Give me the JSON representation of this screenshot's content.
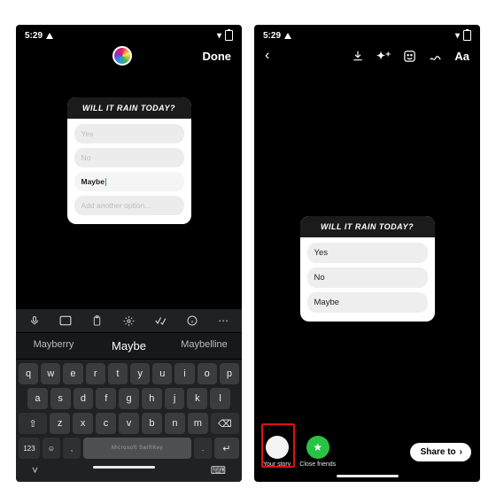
{
  "status": {
    "time": "5:29"
  },
  "left": {
    "toolbar": {
      "done": "Done"
    },
    "poll": {
      "title": "WILL IT RAIN TODAY?",
      "opt1_placeholder": "Yes",
      "opt2_placeholder": "No",
      "opt3_value": "Maybe",
      "add_placeholder": "Add another option..."
    },
    "keyboard": {
      "suggestions": {
        "left": "Mayberry",
        "mid": "Maybe",
        "right": "Maybelline"
      },
      "row1": [
        "q",
        "w",
        "e",
        "r",
        "t",
        "y",
        "u",
        "i",
        "o",
        "p"
      ],
      "row2": [
        "a",
        "s",
        "d",
        "f",
        "g",
        "h",
        "j",
        "k",
        "l"
      ],
      "row3": [
        "z",
        "x",
        "c",
        "v",
        "b",
        "n",
        "m"
      ],
      "shift": "⇧",
      "back": "⌫",
      "num": "123",
      "emoji": "☺",
      "comma": ",",
      "period": ".",
      "enter": "↵",
      "space_label": "Microsoft SwiftKey",
      "nav_down": "˅",
      "nav_kb": "⌨"
    }
  },
  "right": {
    "tools": {
      "back": "‹",
      "download": "↓",
      "effects": "✦⁺",
      "sticker": "☺",
      "draw": "§",
      "text": "Aa"
    },
    "poll": {
      "title": "WILL IT RAIN TODAY?",
      "opt1": "Yes",
      "opt2": "No",
      "opt3": "Maybe"
    },
    "share": {
      "your_story": "Your story",
      "close_friends": "Close friends",
      "share_to": "Share to",
      "chevron": "›"
    }
  }
}
